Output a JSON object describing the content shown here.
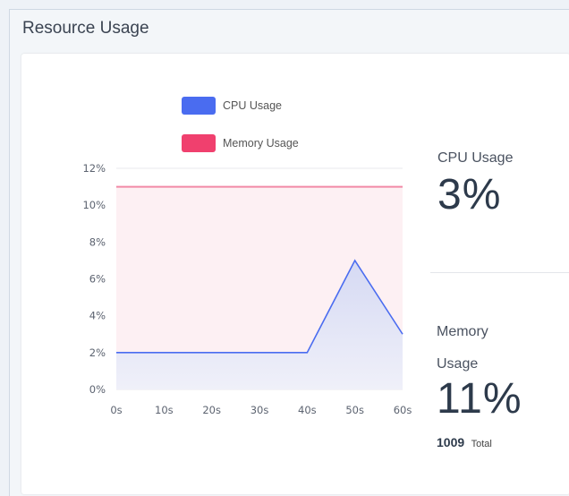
{
  "panel": {
    "title": "Resource Usage"
  },
  "stats": {
    "cpu_label": "CPU Usage",
    "cpu_value": "3%",
    "memory_label_line1": "Memory",
    "memory_label_line2": "Usage",
    "memory_value": "11%",
    "memory_total_number": "1009",
    "memory_total_label": "Total"
  },
  "colors": {
    "cpu": "#4a6cf0",
    "memory": "#f0406e",
    "memory_fill": "#fdf0f3",
    "cpu_fill": "#d3d8f3"
  },
  "chart_data": {
    "type": "line",
    "x": [
      "0s",
      "10s",
      "20s",
      "30s",
      "40s",
      "50s",
      "60s"
    ],
    "yticks": [
      "0%",
      "2%",
      "4%",
      "6%",
      "8%",
      "10%",
      "12%"
    ],
    "ylim": [
      0,
      12
    ],
    "grid": true,
    "legend_position": "top",
    "series": [
      {
        "name": "CPU Usage",
        "values": [
          2,
          2,
          2,
          2,
          2,
          7,
          3
        ]
      },
      {
        "name": "Memory Usage",
        "values": [
          11,
          11,
          11,
          11,
          11,
          11,
          11
        ]
      }
    ]
  }
}
